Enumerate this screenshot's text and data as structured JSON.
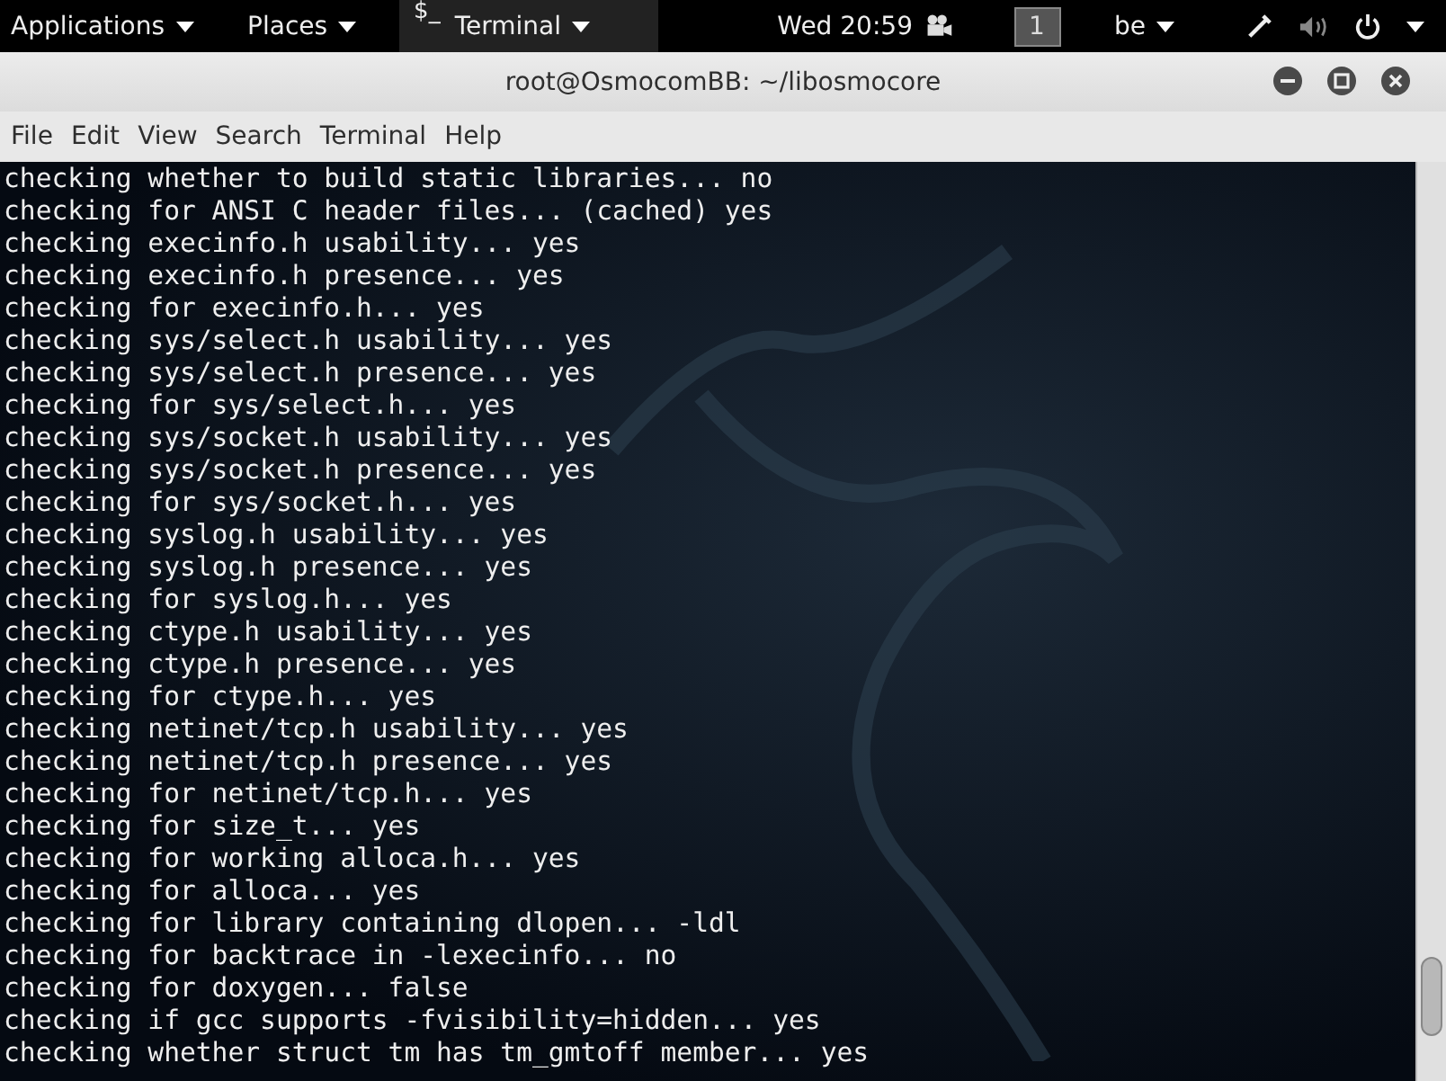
{
  "top_bar": {
    "applications": "Applications",
    "places": "Places",
    "terminal_glyph": "$_",
    "terminal_menu": "Terminal",
    "clock": "Wed 20:59",
    "workspace": "1",
    "keyboard": "be"
  },
  "window": {
    "title": "root@OsmocomBB: ~/libosmocore"
  },
  "menu": [
    "File",
    "Edit",
    "View",
    "Search",
    "Terminal",
    "Help"
  ],
  "terminal_lines": [
    "checking whether to build static libraries... no",
    "checking for ANSI C header files... (cached) yes",
    "checking execinfo.h usability... yes",
    "checking execinfo.h presence... yes",
    "checking for execinfo.h... yes",
    "checking sys/select.h usability... yes",
    "checking sys/select.h presence... yes",
    "checking for sys/select.h... yes",
    "checking sys/socket.h usability... yes",
    "checking sys/socket.h presence... yes",
    "checking for sys/socket.h... yes",
    "checking syslog.h usability... yes",
    "checking syslog.h presence... yes",
    "checking for syslog.h... yes",
    "checking ctype.h usability... yes",
    "checking ctype.h presence... yes",
    "checking for ctype.h... yes",
    "checking netinet/tcp.h usability... yes",
    "checking netinet/tcp.h presence... yes",
    "checking for netinet/tcp.h... yes",
    "checking for size_t... yes",
    "checking for working alloca.h... yes",
    "checking for alloca... yes",
    "checking for library containing dlopen... -ldl",
    "checking for backtrace in -lexecinfo... no",
    "checking for doxygen... false",
    "checking if gcc supports -fvisibility=hidden... yes",
    "checking whether struct tm has tm_gmtoff member... yes"
  ]
}
